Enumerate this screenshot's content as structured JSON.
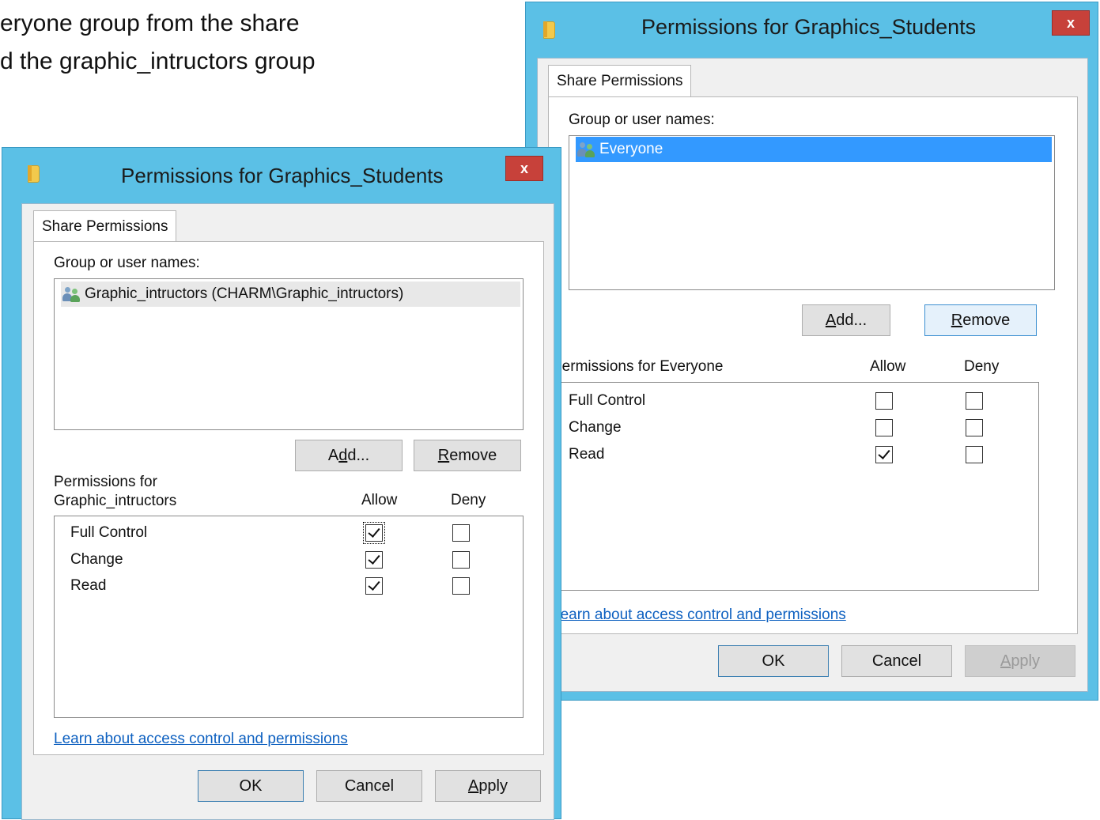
{
  "slide": {
    "line1": "eryone group from the share",
    "line2": "d the graphic_intructors group"
  },
  "colors": {
    "window_frame": "#5bc0e6",
    "close_button": "#c7413a",
    "selection": "#3399ff",
    "link": "#0d60c0"
  },
  "dialogs": {
    "left": {
      "title": "Permissions for Graphics_Students",
      "close_label": "x",
      "tab_label": "Share Permissions",
      "group_label": "Group or user names:",
      "users": [
        {
          "name": "Graphic_intructors (CHARM\\Graphic_intructors)",
          "icon": "users-icon"
        }
      ],
      "add_label": "Add...",
      "remove_label": "Remove",
      "permissions_for_line1": "Permissions for",
      "permissions_for_line2": "Graphic_intructors",
      "allow_header": "Allow",
      "deny_header": "Deny",
      "permissions": [
        {
          "name": "Full Control",
          "allow": true,
          "deny": false
        },
        {
          "name": "Change",
          "allow": true,
          "deny": false
        },
        {
          "name": "Read",
          "allow": true,
          "deny": false
        }
      ],
      "learn_link": "Learn about access control and permissions",
      "ok_label": "OK",
      "cancel_label": "Cancel",
      "apply_label": "Apply"
    },
    "right": {
      "title": "Permissions for Graphics_Students",
      "close_label": "x",
      "tab_label": "Share Permissions",
      "group_label": "Group or user names:",
      "users": [
        {
          "name": "Everyone",
          "icon": "users-icon"
        }
      ],
      "add_label": "Add...",
      "remove_label": "Remove",
      "permissions_for": "Permissions for Everyone",
      "allow_header": "Allow",
      "deny_header": "Deny",
      "permissions": [
        {
          "name": "Full Control",
          "allow": false,
          "deny": false
        },
        {
          "name": "Change",
          "allow": false,
          "deny": false
        },
        {
          "name": "Read",
          "allow": true,
          "deny": false
        }
      ],
      "learn_link": "Learn about access control and permissions",
      "ok_label": "OK",
      "cancel_label": "Cancel",
      "apply_label": "Apply"
    }
  }
}
